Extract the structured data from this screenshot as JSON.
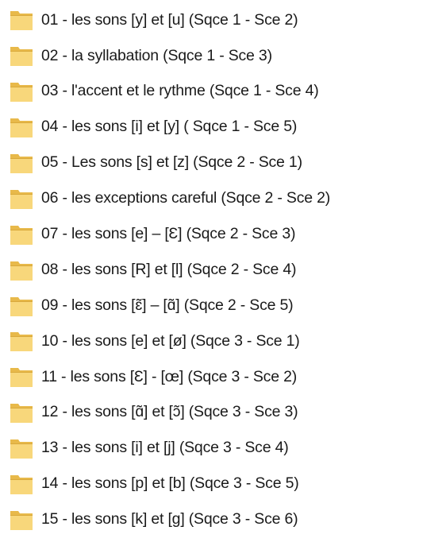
{
  "folder_icon_colors": {
    "body": "#F8D77B",
    "back": "#E8B94A",
    "edge": "#D9A93C"
  },
  "folders": [
    {
      "name": "01 - les sons [y] et [u] (Sqce 1 - Sce 2)",
      "icon": "folder-icon"
    },
    {
      "name": "02 - la syllabation (Sqce 1 - Sce 3)",
      "icon": "folder-icon"
    },
    {
      "name": "03 - l'accent et le rythme (Sqce 1 - Sce 4)",
      "icon": "folder-icon"
    },
    {
      "name": "04 - les sons [i] et [y] ( Sqce 1 - Sce 5)",
      "icon": "folder-icon"
    },
    {
      "name": "05 - Les sons [s] et [z] (Sqce 2 - Sce 1)",
      "icon": "folder-icon"
    },
    {
      "name": "06 - les exceptions careful (Sqce 2 - Sce 2)",
      "icon": "folder-icon"
    },
    {
      "name": "07 - les sons [e] – [Ɛ] (Sqce 2 - Sce 3)",
      "icon": "folder-icon"
    },
    {
      "name": "08 - les sons [R] et [l] (Sqce 2 - Sce 4)",
      "icon": "folder-icon"
    },
    {
      "name": "09 - les sons [ɛ̃] – [ɑ̃] (Sqce 2 - Sce 5)",
      "icon": "folder-icon"
    },
    {
      "name": "10 - les sons  [e] et [ø] (Sqce 3 - Sce 1)",
      "icon": "folder-icon"
    },
    {
      "name": "11 - les sons [Ɛ] - [œ] (Sqce 3 - Sce 2)",
      "icon": "folder-icon"
    },
    {
      "name": "12 - les sons [ɑ̃] et [ɔ̃] (Sqce 3 - Sce 3)",
      "icon": "folder-icon"
    },
    {
      "name": "13 - les sons [i] et [j] (Sqce 3 - Sce 4)",
      "icon": "folder-icon"
    },
    {
      "name": "14 - les sons [p] et [b] (Sqce 3 - Sce 5)",
      "icon": "folder-icon"
    },
    {
      "name": "15 - les sons [k] et [g] (Sqce 3 - Sce 6)",
      "icon": "folder-icon"
    }
  ]
}
